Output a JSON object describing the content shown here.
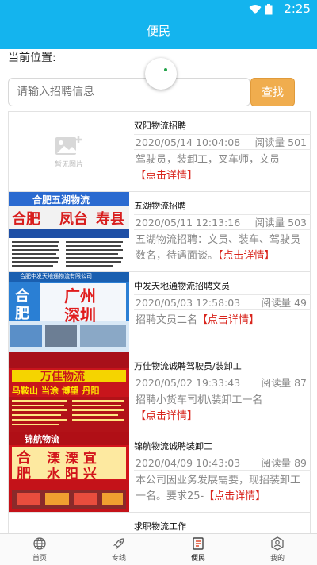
{
  "status": {
    "time": "2:25"
  },
  "header": {
    "title": "便民"
  },
  "location": {
    "label": "当前位置:"
  },
  "search": {
    "placeholder": "请输入招聘信息",
    "button": "查找"
  },
  "posts": [
    {
      "title": "双阳物流招聘",
      "date": "2020/05/14 10:04:08",
      "reads": "阅读量 501",
      "desc": "驾驶员，装卸工，叉车师，文员",
      "detail": "【点击详情】",
      "thumb": "placeholder",
      "thumb_label": "暂无图片"
    },
    {
      "title": "五湖物流招聘",
      "date": "2020/05/11 12:13:16",
      "reads": "阅读量 503",
      "desc": "五湖物流招聘：文员、装车、驾驶员数名，待遇面谈。",
      "detail": "【点击详情】",
      "thumb": "poster-wuhu",
      "poster": {
        "head": "合肥五湖物流",
        "line1": "合肥",
        "mid": "凤台",
        "line2": "寿县"
      }
    },
    {
      "title": "中发天地通物流招聘文员",
      "date": "2020/05/03 12:58:03",
      "reads": "阅读量 49",
      "desc": "招聘文员二名",
      "detail": "【点击详情】",
      "thumb": "poster-zhongfa",
      "poster": {
        "head": "合肥中发天地通物流有限公司",
        "l1": "合",
        "l2": "肥",
        "r1": "广州",
        "r2": "深圳"
      }
    },
    {
      "title": "万佳物流诚聘驾驶员/装卸工",
      "date": "2020/05/02 19:33:43",
      "reads": "阅读量 87",
      "desc": "招聘小货车司机\\装卸工一名",
      "detail": "【点击详情】",
      "thumb": "poster-wanjia",
      "poster": {
        "head": "万佳物流",
        "line": "马鞍山 当涂 博望 丹阳"
      }
    },
    {
      "title": "锦航物流诚聘装卸工",
      "date": "2020/04/09 10:43:03",
      "reads": "阅读量 89",
      "desc": "本公司因业务发展需要，现招装卸工一名。要求25-",
      "detail": "【点击详情】",
      "thumb": "poster-jinhang",
      "poster": {
        "head": "锦航物流",
        "l1": "合",
        "l2": "肥",
        "r1": "溧 溧 宜",
        "r2": "水 阳 兴"
      }
    },
    {
      "title": "求职物流工作",
      "date": "",
      "reads": "",
      "desc": "",
      "detail": "",
      "thumb": "none"
    }
  ],
  "tabs": [
    {
      "label": "首页",
      "icon": "globe-icon"
    },
    {
      "label": "专线",
      "icon": "rocket-icon"
    },
    {
      "label": "便民",
      "icon": "document-icon"
    },
    {
      "label": "我的",
      "icon": "user-icon"
    }
  ],
  "colors": {
    "primary": "#14b4ee",
    "search_button": "#f0ad4e",
    "detail_link": "#d9251d"
  }
}
